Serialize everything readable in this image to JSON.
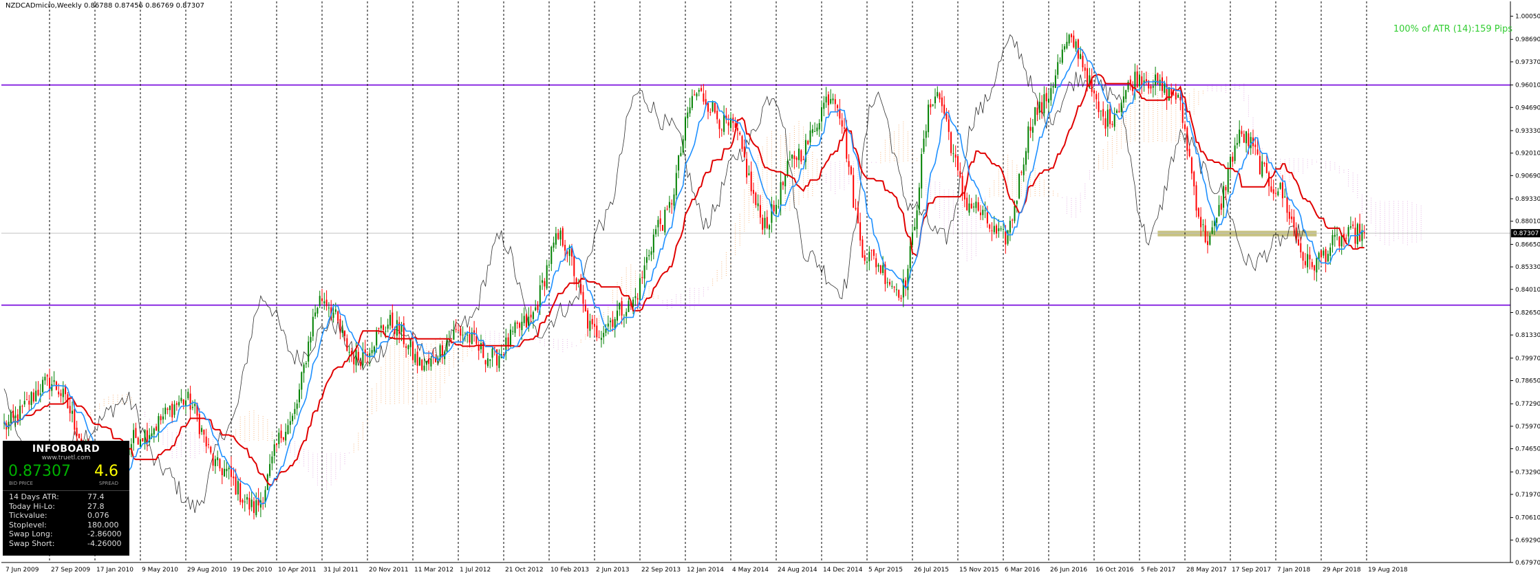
{
  "header": {
    "symbol_info": "NZDCADmicro,Weekly  0.86788 0.87456 0.86769 0.87307",
    "atr_text": "100% of ATR (14):159 Pips"
  },
  "infoboard": {
    "title": "INFOBOARD",
    "site": "www.truetl.com",
    "bid": "0.87307",
    "bid_caption": "BID PRICE",
    "spread": "4.6",
    "spread_caption": "SPREAD",
    "rows": [
      {
        "key": "14 Days ATR:",
        "value": "77.4"
      },
      {
        "key": "Today Hi-Lo:",
        "value": "27.8"
      },
      {
        "key": "Tickvalue:",
        "value": "0.076"
      },
      {
        "key": "Stoplevel:",
        "value": "180.000"
      },
      {
        "key": "Swap Long:",
        "value": "-2.86000"
      },
      {
        "key": "Swap Short:",
        "value": "-4.26000"
      }
    ]
  },
  "colors": {
    "bull": "#008000",
    "bear": "#ff0000",
    "kijun": "#e00000",
    "tenkan": "#1e90ff",
    "chikou": "#303030",
    "cloud_a": "#f4a460",
    "cloud_b": "#dda0dd",
    "level": "#8a2be2",
    "zone": "#bdb76b",
    "grid": "#000000"
  },
  "chart_data": {
    "type": "candlestick",
    "ylim": [
      0.6797,
      1.0092
    ],
    "y_ticks": [
      "1.00050",
      "0.98690",
      "0.97370",
      "0.96010",
      "0.94690",
      "0.93330",
      "0.92010",
      "0.90690",
      "0.89330",
      "0.88010",
      "0.86650",
      "0.85330",
      "0.84010",
      "0.82650",
      "0.81330",
      "0.79970",
      "0.78650",
      "0.77290",
      "0.75970",
      "0.74650",
      "0.73290",
      "0.71970",
      "0.70610",
      "0.69290",
      "0.67970"
    ],
    "current_price": "0.87307",
    "x_labels": [
      "7 Jun 2009",
      "27 Sep 2009",
      "17 Jan 2010",
      "9 May 2010",
      "29 Aug 2010",
      "19 Dec 2010",
      "10 Apr 2011",
      "31 Jul 2011",
      "20 Nov 2011",
      "11 Mar 2012",
      "1 Jul 2012",
      "21 Oct 2012",
      "10 Feb 2013",
      "2 Jun 2013",
      "22 Sep 2013",
      "12 Jan 2014",
      "4 May 2014",
      "24 Aug 2014",
      "14 Dec 2014",
      "5 Apr 2015",
      "26 Jul 2015",
      "15 Nov 2015",
      "6 Mar 2016",
      "26 Jun 2016",
      "16 Oct 2016",
      "5 Feb 2017",
      "28 May 2017",
      "17 Sep 2017",
      "7 Jan 2018",
      "29 Apr 2018",
      "19 Aug 2018"
    ],
    "levels": [
      0.9601,
      0.8308
    ],
    "zone": [
      0.8712,
      0.8745
    ],
    "anchors": [
      [
        0,
        0.76
      ],
      [
        20,
        0.785
      ],
      [
        45,
        0.728
      ],
      [
        60,
        0.755
      ],
      [
        80,
        0.775
      ],
      [
        95,
        0.735
      ],
      [
        110,
        0.712
      ],
      [
        125,
        0.76
      ],
      [
        140,
        0.835
      ],
      [
        155,
        0.8
      ],
      [
        170,
        0.82
      ],
      [
        185,
        0.795
      ],
      [
        200,
        0.815
      ],
      [
        215,
        0.8
      ],
      [
        230,
        0.82
      ],
      [
        245,
        0.87
      ],
      [
        260,
        0.815
      ],
      [
        275,
        0.83
      ],
      [
        290,
        0.88
      ],
      [
        305,
        0.955
      ],
      [
        320,
        0.935
      ],
      [
        335,
        0.88
      ],
      [
        350,
        0.92
      ],
      [
        365,
        0.955
      ],
      [
        380,
        0.86
      ],
      [
        395,
        0.84
      ],
      [
        410,
        0.955
      ],
      [
        425,
        0.89
      ],
      [
        440,
        0.87
      ],
      [
        455,
        0.945
      ],
      [
        470,
        0.985
      ],
      [
        485,
        0.94
      ],
      [
        500,
        0.965
      ],
      [
        515,
        0.955
      ],
      [
        530,
        0.87
      ],
      [
        545,
        0.93
      ],
      [
        560,
        0.9
      ],
      [
        575,
        0.855
      ],
      [
        590,
        0.87
      ],
      [
        596,
        0.873
      ]
    ]
  }
}
